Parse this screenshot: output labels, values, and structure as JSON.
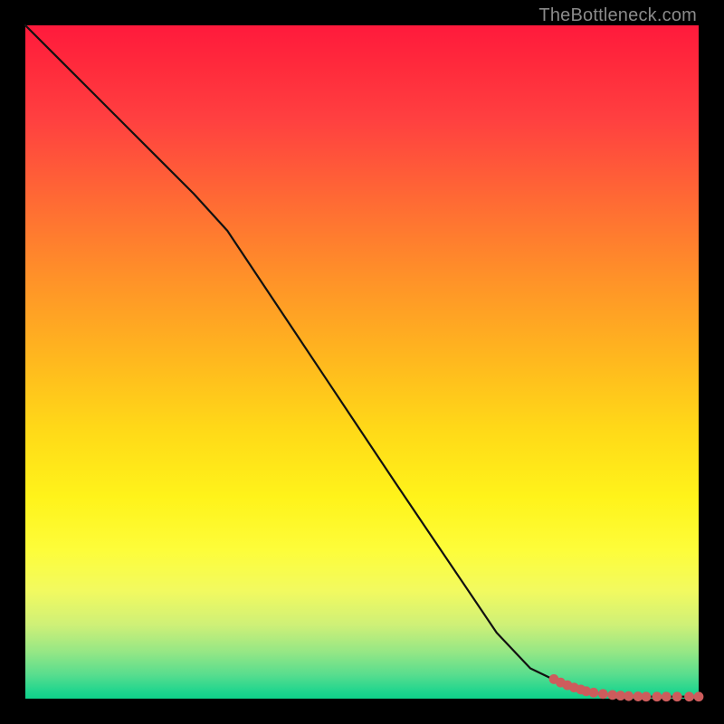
{
  "attribution": "TheBottleneck.com",
  "colors": {
    "frame": "#000000",
    "curve": "#111111",
    "marker": "#cd5c5c",
    "gradient_top": "#ff1a3c",
    "gradient_bottom": "#0fd18a"
  },
  "chart_data": {
    "type": "line",
    "title": "",
    "xlabel": "",
    "ylabel": "",
    "xlim": [
      0,
      100
    ],
    "ylim": [
      0,
      100
    ],
    "series": [
      {
        "name": "curve",
        "x": [
          0,
          5,
          10,
          15,
          20,
          25,
          30,
          35,
          40,
          45,
          50,
          55,
          60,
          65,
          70,
          75,
          80,
          83,
          85,
          87,
          89,
          91,
          93,
          95,
          97,
          99,
          100
        ],
        "y": [
          100,
          95,
          90,
          85,
          80,
          75,
          69.5,
          62,
          54.5,
          47,
          39.5,
          32,
          24.6,
          17.2,
          9.8,
          4.5,
          2.1,
          1.2,
          0.8,
          0.55,
          0.4,
          0.3,
          0.3,
          0.3,
          0.3,
          0.3,
          0.3
        ]
      }
    ],
    "markers": {
      "name": "highlight-points",
      "x": [
        78.5,
        79.5,
        80.5,
        81.5,
        82.5,
        83.3,
        84.4,
        85.8,
        87.2,
        88.4,
        89.6,
        91.0,
        92.2,
        93.8,
        95.2,
        96.8,
        98.6,
        100.0
      ],
      "y": [
        2.9,
        2.4,
        2.0,
        1.65,
        1.35,
        1.1,
        0.9,
        0.7,
        0.55,
        0.45,
        0.38,
        0.33,
        0.3,
        0.3,
        0.3,
        0.3,
        0.3,
        0.3
      ]
    }
  }
}
